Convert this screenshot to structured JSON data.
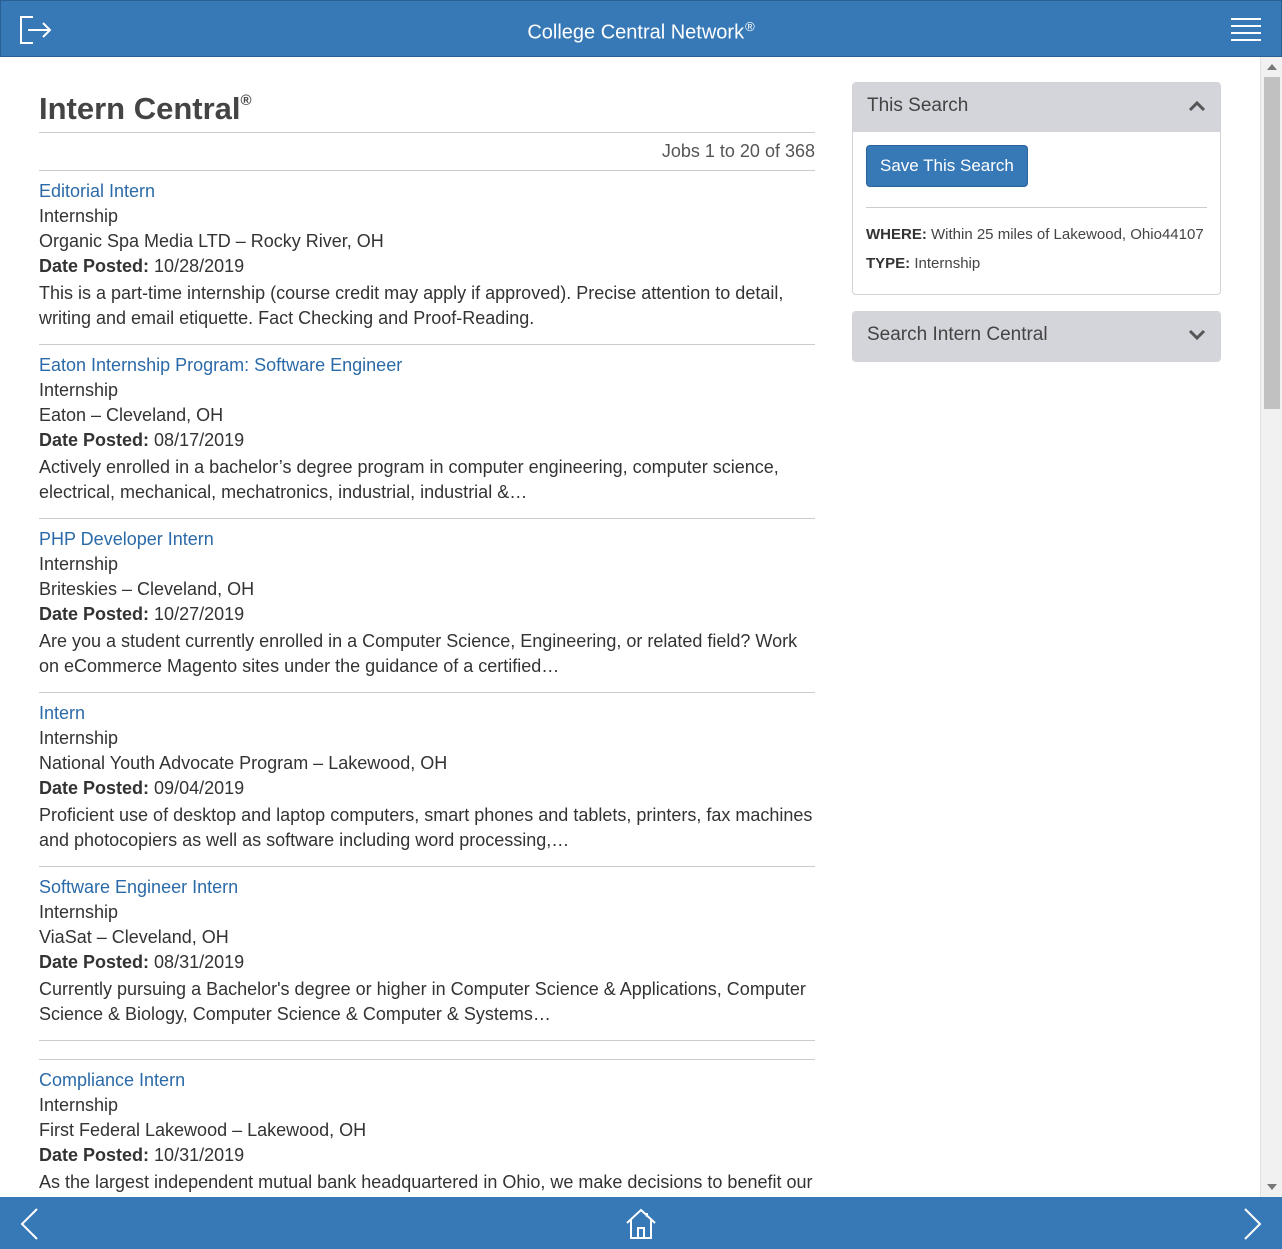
{
  "header": {
    "title": "College Central Network",
    "reg": "®"
  },
  "main": {
    "title": "Intern Central",
    "title_reg": "®",
    "results_count": "Jobs 1 to 20 of 368",
    "jobs": [
      {
        "title": "Editorial Intern",
        "type": "Internship",
        "company": "Organic Spa Media LTD – Rocky River, OH",
        "date_label": "Date Posted:",
        "date": "10/28/2019",
        "desc": "This is a part-time internship (course credit may apply if approved). Precise attention to detail, writing and email etiquette. Fact Checking and Proof-Reading."
      },
      {
        "title": "Eaton Internship Program: Software Engineer",
        "type": "Internship",
        "company": "Eaton – Cleveland, OH",
        "date_label": "Date Posted:",
        "date": "08/17/2019",
        "desc": "Actively enrolled in a bachelor’s degree program in computer engineering, computer science, electrical, mechanical, mechatronics, industrial, industrial &…"
      },
      {
        "title": "PHP Developer Intern",
        "type": "Internship",
        "company": "Briteskies – Cleveland, OH",
        "date_label": "Date Posted:",
        "date": "10/27/2019",
        "desc": "Are you a student currently enrolled in a Computer Science, Engineering, or related field? Work on eCommerce Magento sites under the guidance of a certified…"
      },
      {
        "title": "Intern",
        "type": "Internship",
        "company": "National Youth Advocate Program – Lakewood, OH",
        "date_label": "Date Posted:",
        "date": "09/04/2019",
        "desc": "Proficient use of desktop and laptop computers, smart phones and tablets, printers, fax machines and photocopiers as well as software including word processing,…"
      },
      {
        "title": "Software Engineer Intern",
        "type": "Internship",
        "company": "ViaSat – Cleveland, OH",
        "date_label": "Date Posted:",
        "date": "08/31/2019",
        "desc": "Currently pursuing a Bachelor's degree or higher in Computer Science & Applications, Computer Science & Biology, Computer Science & Computer & Systems…"
      },
      {
        "title": "Compliance Intern",
        "type": "Internship",
        "company": "First Federal Lakewood – Lakewood, OH",
        "date_label": "Date Posted:",
        "date": "10/31/2019",
        "desc": "As the largest independent mutual bank headquartered in Ohio, we make decisions to benefit our customers, not stockholders. We’re Proud to Be Here. We’ll Be Here…"
      }
    ]
  },
  "sidebar": {
    "this_search": {
      "heading": "This Search",
      "save_label": "Save This Search",
      "where_label": "WHERE:",
      "where_value": "Within 25 miles of Lakewood, Ohio44107",
      "type_label": "TYPE:",
      "type_value": "Internship"
    },
    "search_panel": {
      "heading": "Search Intern Central"
    }
  },
  "icons": {
    "logout": "logout-icon",
    "menu": "hamburger-menu-icon",
    "back": "chevron-left-icon",
    "home": "home-icon",
    "forward": "chevron-right-icon"
  },
  "colors": {
    "brand": "#3779b7",
    "link": "#2b6aa8",
    "panel_header": "#d4d5da"
  }
}
